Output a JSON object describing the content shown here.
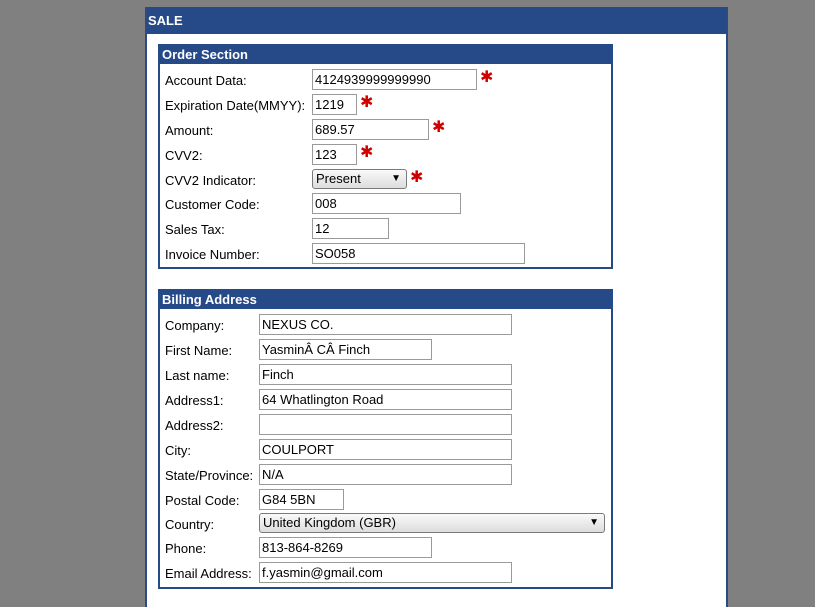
{
  "panel": {
    "title": "SALE"
  },
  "order": {
    "title": "Order Section",
    "fields": {
      "account_data": {
        "label": "Account Data:",
        "value": "4124939999999990"
      },
      "expiration": {
        "label": "Expiration Date(MMYY):",
        "value": "1219"
      },
      "amount": {
        "label": "Amount:",
        "value": "689.57"
      },
      "cvv2": {
        "label": "CVV2:",
        "value": "123"
      },
      "cvv2_indicator": {
        "label": "CVV2 Indicator:",
        "value": "Present"
      },
      "customer_code": {
        "label": "Customer Code:",
        "value": "008"
      },
      "sales_tax": {
        "label": "Sales Tax:",
        "value": "12"
      },
      "invoice_number": {
        "label": "Invoice Number:",
        "value": "SO058"
      }
    },
    "required_mark": "✱"
  },
  "billing": {
    "title": "Billing Address",
    "fields": {
      "company": {
        "label": "Company:",
        "value": "NEXUS CO."
      },
      "first_name": {
        "label": "First Name:",
        "value": "YasminÂ CÂ Finch"
      },
      "last_name": {
        "label": "Last name:",
        "value": "Finch"
      },
      "address1": {
        "label": "Address1:",
        "value": "64 Whatlington Road"
      },
      "address2": {
        "label": "Address2:",
        "value": ""
      },
      "city": {
        "label": "City:",
        "value": "COULPORT"
      },
      "state": {
        "label": "State/Province:",
        "value": "N/A"
      },
      "postal_code": {
        "label": "Postal Code:",
        "value": "G84 5BN"
      },
      "country": {
        "label": "Country:",
        "value": "United Kingdom (GBR)"
      },
      "phone": {
        "label": "Phone:",
        "value": "813-864-8269"
      },
      "email": {
        "label": "Email Address:",
        "value": "f.yasmin@gmail.com"
      }
    }
  },
  "colors": {
    "header_bg": "#264a87",
    "required": "#d00000",
    "page_bg": "#808080"
  },
  "icons": {
    "dropdown": "chevron-down-icon",
    "required": "asterisk-icon"
  }
}
